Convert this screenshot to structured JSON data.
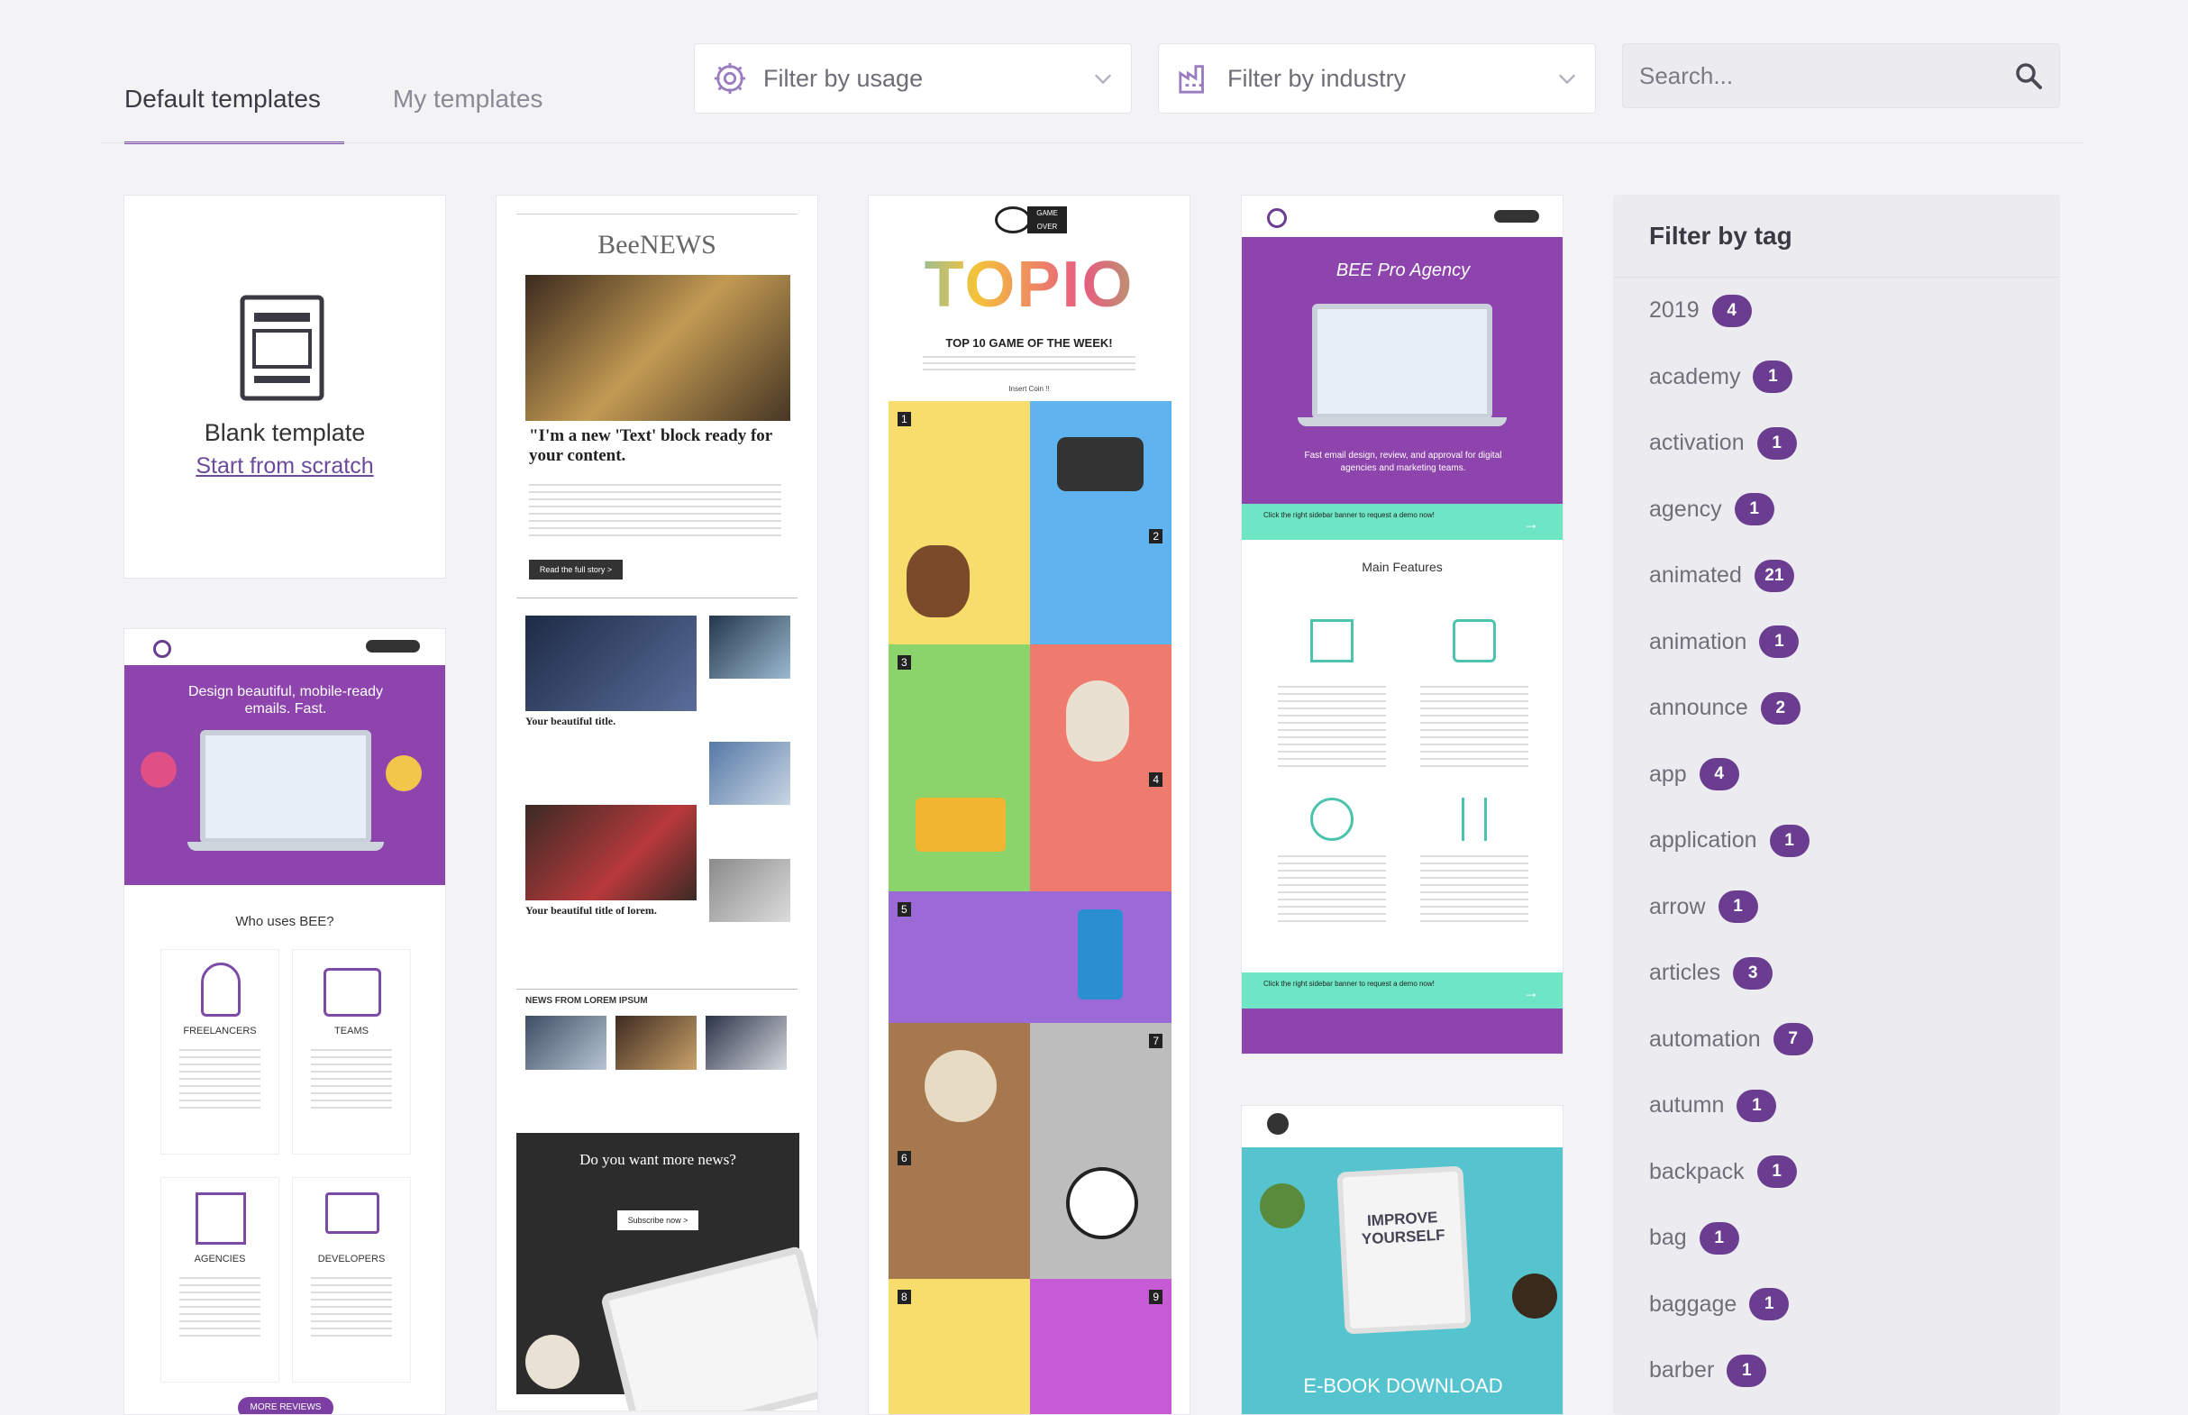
{
  "tabs": [
    {
      "label": "Default templates"
    },
    {
      "label": "My templates"
    }
  ],
  "filters": {
    "usage_label": "Filter by usage",
    "industry_label": "Filter by industry",
    "search_placeholder": "Search..."
  },
  "blank_template": {
    "title": "Blank template",
    "link": "Start from scratch"
  },
  "previews": {
    "bee_pro": {
      "headline": "Design beautiful, mobile-ready emails. Fast.",
      "section": "Who uses BEE?",
      "roles": [
        "FREELANCERS",
        "TEAMS",
        "AGENCIES",
        "DEVELOPERS"
      ],
      "button": "MORE REVIEWS"
    },
    "beenews": {
      "masthead": "BeeNEWS",
      "headline": "\"I'm a new 'Text' block ready for your content.",
      "cta": "Read the full story >",
      "story1": "Your beautiful title.",
      "story2": "Your beautiful title of lorem.",
      "news_heading": "NEWS FROM LOREM IPSUM",
      "promo": "Do you want more news?",
      "promo_cta": "Subscribe now >"
    },
    "topio": {
      "logo": "TOPIO",
      "headline": "TOP 10 GAME OF THE WEEK!",
      "badge": "GAME OVER",
      "insert": "Insert Coin !!",
      "items": [
        "1",
        "2",
        "3",
        "4",
        "5",
        "6",
        "7",
        "8",
        "9"
      ]
    },
    "agency": {
      "title": "BEE Pro Agency",
      "subtitle": "Fast email design, review, and approval for digital agencies and marketing teams.",
      "banner": "Click the right sidebar banner to request a demo now!",
      "features_title": "Main Features"
    },
    "ebook": {
      "title": "E-BOOK DOWNLOAD",
      "book_text": "IMPROVE YOURSELF"
    }
  },
  "tag_panel": {
    "title": "Filter by tag",
    "tags": [
      {
        "name": "2019",
        "count": "4"
      },
      {
        "name": "academy",
        "count": "1"
      },
      {
        "name": "activation",
        "count": "1"
      },
      {
        "name": "agency",
        "count": "1"
      },
      {
        "name": "animated",
        "count": "21"
      },
      {
        "name": "animation",
        "count": "1"
      },
      {
        "name": "announce",
        "count": "2"
      },
      {
        "name": "app",
        "count": "4"
      },
      {
        "name": "application",
        "count": "1"
      },
      {
        "name": "arrow",
        "count": "1"
      },
      {
        "name": "articles",
        "count": "3"
      },
      {
        "name": "automation",
        "count": "7"
      },
      {
        "name": "autumn",
        "count": "1"
      },
      {
        "name": "backpack",
        "count": "1"
      },
      {
        "name": "bag",
        "count": "1"
      },
      {
        "name": "baggage",
        "count": "1"
      },
      {
        "name": "barber",
        "count": "1"
      }
    ]
  },
  "colors": {
    "accent": "#6b3d90",
    "bee_purple": "#8e44ad",
    "mint": "#6ee6c6",
    "topio_yellow": "#f7dd6b",
    "topio_blue": "#5fb4ef",
    "topio_green": "#8bd36b",
    "topio_red": "#ef7a6e",
    "topio_violet": "#9b6ad6",
    "ebook_teal": "#55c4cf"
  }
}
